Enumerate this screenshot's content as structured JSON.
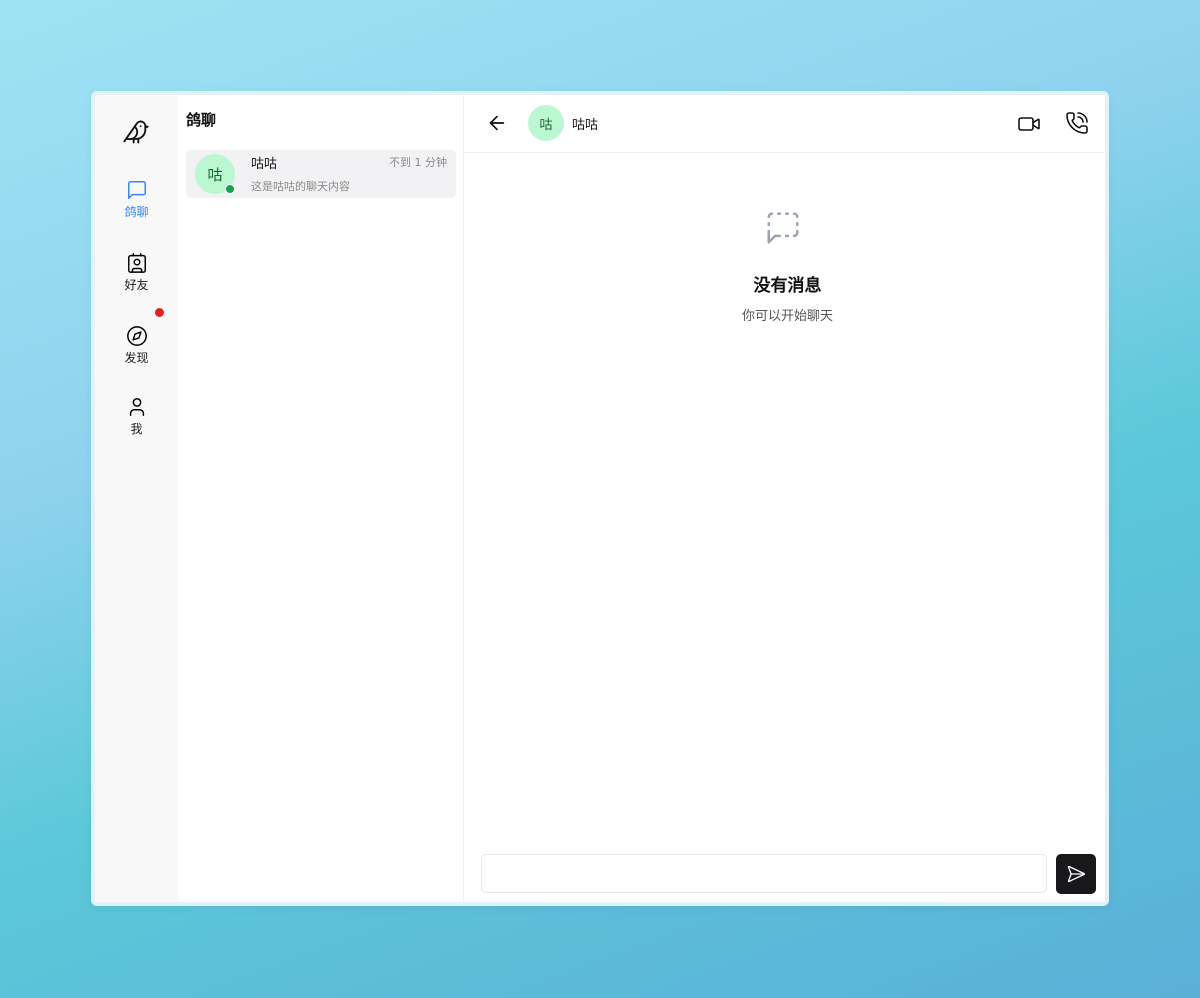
{
  "nav": {
    "logo_icon": "bird-logo-icon",
    "items": [
      {
        "label": "鸽聊",
        "icon": "message-square-icon",
        "active": true
      },
      {
        "label": "好友",
        "icon": "contact-card-icon",
        "active": false
      },
      {
        "label": "发现",
        "icon": "compass-icon",
        "active": false,
        "notification": true
      },
      {
        "label": "我",
        "icon": "user-icon",
        "active": false
      }
    ]
  },
  "conversation_list": {
    "title": "鸽聊",
    "items": [
      {
        "avatar_text": "咕",
        "name": "咕咕",
        "time": "不到 1 分钟",
        "preview": "这是咕咕的聊天内容",
        "online": true
      }
    ]
  },
  "chat": {
    "header": {
      "avatar_text": "咕",
      "name": "咕咕"
    },
    "empty_state": {
      "title": "没有消息",
      "subtitle": "你可以开始聊天"
    },
    "input": {
      "value": "",
      "placeholder": ""
    }
  },
  "colors": {
    "accent": "#3b82f6",
    "avatar_bg": "#bbf7d0",
    "online": "#16a34a",
    "notification": "#dc2626",
    "send_button": "#18181b"
  }
}
